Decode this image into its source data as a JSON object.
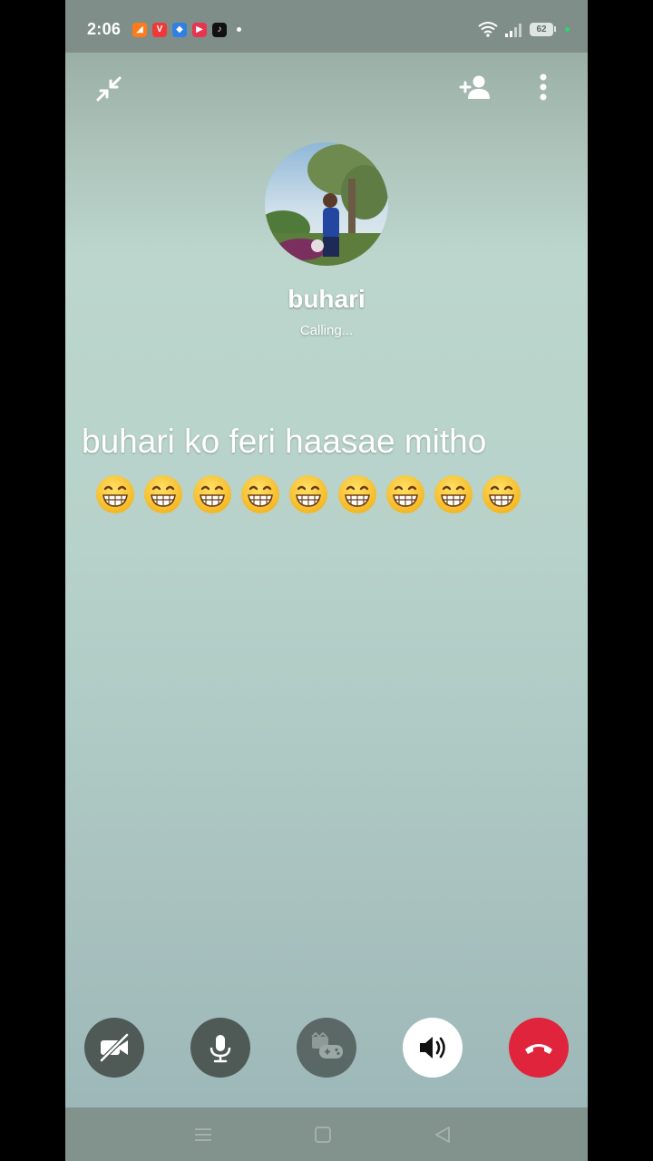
{
  "status_bar": {
    "time": "2:06",
    "battery": "62",
    "app_icons": [
      {
        "name": "tool-app-icon",
        "color": "#ff7a1a",
        "glyph": "◢"
      },
      {
        "name": "vivaldi-app-icon",
        "color": "#ef3939",
        "glyph": "V"
      },
      {
        "name": "blue-app-icon",
        "color": "#2f7fe6",
        "glyph": "◆"
      },
      {
        "name": "video-app-icon",
        "color": "#e8344f",
        "glyph": "▶"
      },
      {
        "name": "tiktok-app-icon",
        "color": "#111111",
        "glyph": "♪"
      }
    ]
  },
  "caller": {
    "name": "buhari",
    "status": "Calling..."
  },
  "overlay": {
    "caption": "buhari ko feri haasae mitho",
    "emoji_count": 9
  },
  "colors": {
    "end_call": "#e0243b",
    "control_dark": "#4f5a57",
    "speaker_active": "#ffffff"
  }
}
